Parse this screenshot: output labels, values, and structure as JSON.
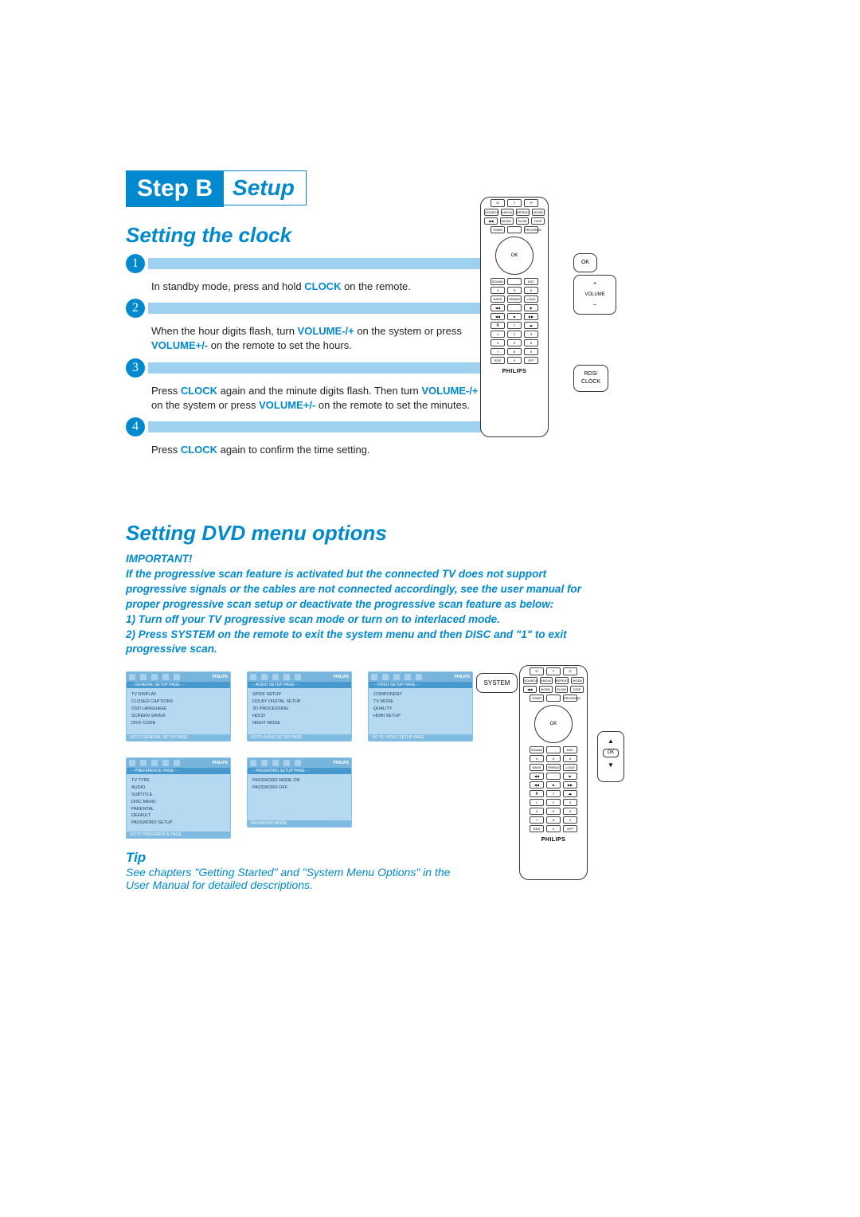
{
  "step": {
    "label_left": "Step B",
    "label_right": "Setup"
  },
  "section1": {
    "title": "Setting the clock",
    "steps": [
      {
        "num": "1",
        "text_pre": "In standby mode, press and hold ",
        "bold1": "CLOCK",
        "text_post": " on the remote."
      },
      {
        "num": "2",
        "text_pre": "When the hour digits flash, turn ",
        "bold1": "VOLUME-/+",
        "text_mid": " on the system or press ",
        "bold2": "VOLUME+/-",
        "text_post": " on the remote to set the hours."
      },
      {
        "num": "3",
        "text_pre": "Press ",
        "bold1": "CLOCK",
        "text_mid": " again and the minute digits flash. Then turn ",
        "bold2": "VOLUME-/+",
        "text_mid2": " on the system or press ",
        "bold3": "VOLUME+/-",
        "text_post": " on the remote to set the minutes."
      },
      {
        "num": "4",
        "text_pre": "Press ",
        "bold1": "CLOCK",
        "text_post": " again to confirm the time setting."
      }
    ]
  },
  "section2": {
    "title": "Setting DVD menu options",
    "important_label": "IMPORTANT!",
    "important_body": "If the progressive scan feature is activated but the connected TV does not support progressive signals or the cables are not connected accordingly, see the user manual for proper progressive scan setup or deactivate the progressive scan feature as below:\n1) Turn off your TV progressive scan mode or turn on to interlaced mode.\n2) Press SYSTEM on the remote to exit the system menu and then DISC and \"1\" to exit progressive scan."
  },
  "menus": [
    {
      "title": "- - GENERAL SETUP PAGE - -",
      "items": [
        "TV DISPLAY",
        "CLOSED CAPTIONS",
        "OSD LANGUAGE",
        "SCREEN SAVER",
        "DIVX CODE"
      ],
      "footer": "GOTO GENERAL SETUP PAGE"
    },
    {
      "title": "- - AUDIO SETUP PAGE - -",
      "items": [
        "SPDIF SETUP",
        "DOLBY DIGITAL SETUP",
        "3D PROCESSING",
        "HDCD",
        "NIGHT MODE"
      ],
      "footer": "GOTO AUDIO SETUP PAGE"
    },
    {
      "title": "- - VIDEO SETUP PAGE - -",
      "items": [
        "COMPONENT",
        "TV MODE",
        "QUALITY",
        "HDMI SETUP"
      ],
      "footer": "GO TO VIDEO SETUP PAGE"
    },
    {
      "title": "- - PREFERENCE PAGE - -",
      "items": [
        "TV TYPE",
        "AUDIO",
        "SUBTITLE",
        "DISC MENU",
        "PARENTAL",
        "DEFAULT",
        "PASSWORD SETUP"
      ],
      "footer": "GOTO PREFERENCE PAGE"
    },
    {
      "title": "- - PASSWORD SETUP PAGE - -",
      "items": [
        "PASSWORD MODE    ON",
        "PASSWORD              OFF"
      ],
      "footer": "PASSWORD MODE"
    }
  ],
  "tip": {
    "title": "Tip",
    "body": "See chapters \"Getting Started\" and \"System Menu Options\" in the User Manual for detailed descriptions."
  },
  "callouts": {
    "ok": "OK",
    "volume_plus": "+",
    "volume_label": "VOLUME",
    "volume_minus": "–",
    "rds_clock": "RDS/\nCLOCK",
    "system": "SYSTEM"
  },
  "remote": {
    "brand": "PHILIPS",
    "dpad_center": "OK",
    "rows_top": [
      [
        "⏻",
        "≡",
        "⦿"
      ],
      [
        "SOURCE",
        "ANGLE",
        "REPEAT",
        "MODE"
      ],
      [
        "◀◀",
        "MODE",
        "SLOW",
        "DISP"
      ],
      [
        "TIMER",
        "",
        "PROGRAM"
      ]
    ],
    "rows_mid": [
      [
        "SOUND",
        "",
        "DSC"
      ],
      [
        "4",
        "5",
        "6"
      ],
      [
        "BASS",
        "TREBLE",
        "LOUD"
      ]
    ],
    "rows_trans": [
      [
        "◀◀",
        "",
        "▶"
      ],
      [
        "◀◀",
        "■",
        "▶▶"
      ],
      [
        "≣",
        "≡",
        "⏏"
      ]
    ],
    "rows_num": [
      [
        "1",
        "2",
        "3"
      ],
      [
        "4",
        "5",
        "6"
      ],
      [
        "7",
        "8",
        "9"
      ],
      [
        "RDS",
        "0",
        "OFF"
      ]
    ]
  }
}
